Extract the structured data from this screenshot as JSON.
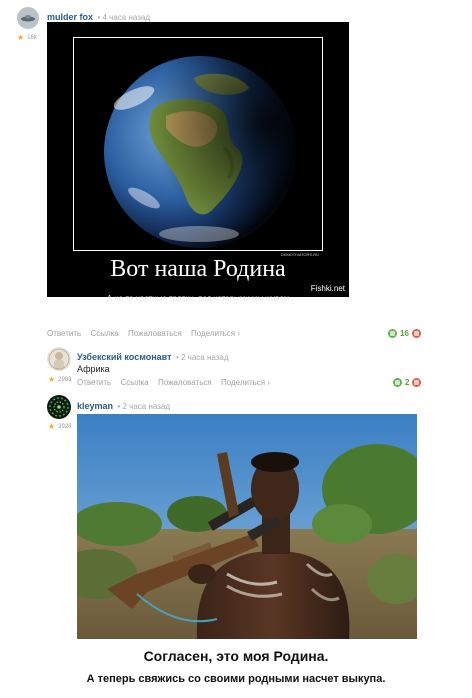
{
  "post": {
    "author": "mulder fox",
    "time": "• 4 часа назад",
    "rank": "16k",
    "demotivator": {
      "title": "Вот наша Родина",
      "subtitle": "А не те цветные тряпки, под которыми мы живем",
      "credit": "DEMOTIVATORS.RU",
      "source": "Fishki.net"
    },
    "actions": [
      "Ответить",
      "Ссылка",
      "Пожаловаться",
      "Поделиться ›"
    ],
    "votes": "16"
  },
  "reply1": {
    "author": "Узбекский космонавт",
    "time": "• 2 часа назад",
    "rank": "2983",
    "text": "Африка",
    "actions": [
      "Ответить",
      "Ссылка",
      "Пожаловаться",
      "Поделиться ›"
    ],
    "votes": "2"
  },
  "reply2": {
    "author": "kleyman",
    "time": "• 2 часа назад",
    "rank": "3928",
    "caption_main": "Согласен, это моя Родина.",
    "caption_sub": "А теперь свяжись со своими родными насчет выкупа."
  },
  "colors": {
    "author": "#2a5b8c",
    "upvote": "#62b346",
    "downvote": "#e05a4a",
    "muted": "#a0a0a0"
  },
  "icons": {
    "star": "star-icon",
    "upvote": "upvote-icon",
    "downvote": "downvote-icon"
  }
}
